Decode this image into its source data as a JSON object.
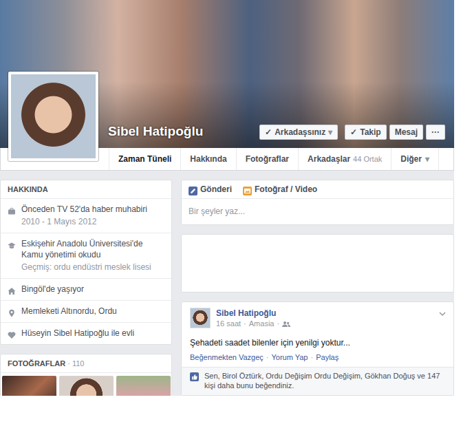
{
  "profile": {
    "name": "Sibel Hatipoğlu",
    "actions": [
      {
        "check": "✓",
        "label": "Arkadaşsınız",
        "caret": "▾"
      },
      {
        "check": "✓",
        "label": "Takip"
      },
      {
        "label": "Mesaj"
      },
      {
        "label": "···"
      }
    ]
  },
  "tabs": [
    {
      "label": "Zaman Tüneli",
      "selected": true
    },
    {
      "label": "Hakkında",
      "selected": false
    },
    {
      "label": "Fotoğraflar",
      "selected": false
    },
    {
      "label": "Arkadaşlar",
      "count": "44 Ortak",
      "selected": false
    },
    {
      "label": "Diğer",
      "caret": "▾",
      "selected": false
    }
  ],
  "about": {
    "title": "HAKKINDA",
    "items": [
      {
        "kind": "work",
        "text": "Önceden TV 52'da haber muhabiri",
        "sub": "2010 - 1 Mayıs 2012"
      },
      {
        "kind": "school",
        "text": "Eskişehir Anadolu Üniversitesi'de Kamu yönetimi okudu",
        "sub": "Geçmiş: ordu endüstri meslek lisesi"
      },
      {
        "kind": "home",
        "text": "Bingöl'de yaşıyor"
      },
      {
        "kind": "hometown",
        "text": "Memleketi Altınordu, Ordu"
      },
      {
        "kind": "relationship",
        "text": "Hüseyin Sibel Hatipoğlu ile evli"
      }
    ]
  },
  "photos": {
    "title": "FOTOĞRAFLAR",
    "sep": "·",
    "count": "110"
  },
  "composer": {
    "tabs": [
      "Gönderi",
      "Fotoğraf / Video"
    ],
    "placeholder": "Bir şeyler yaz..."
  },
  "post": {
    "author": "Sibel Hatipoğlu",
    "time": "16 saat",
    "sep": "·",
    "place": "Amasia",
    "text": "Şehadeti saadet bilenler için yenilgi yoktur...",
    "actions": [
      "Beğenmekten Vazgeç",
      "Yorum Yap",
      "Paylaş"
    ],
    "action_sep": "·",
    "likes": "Sen, Birol Öztürk, Ordu Değişim Ordu Değişim, Gökhan Doğuş ve 147 kişi daha bunu beğendiniz."
  }
}
